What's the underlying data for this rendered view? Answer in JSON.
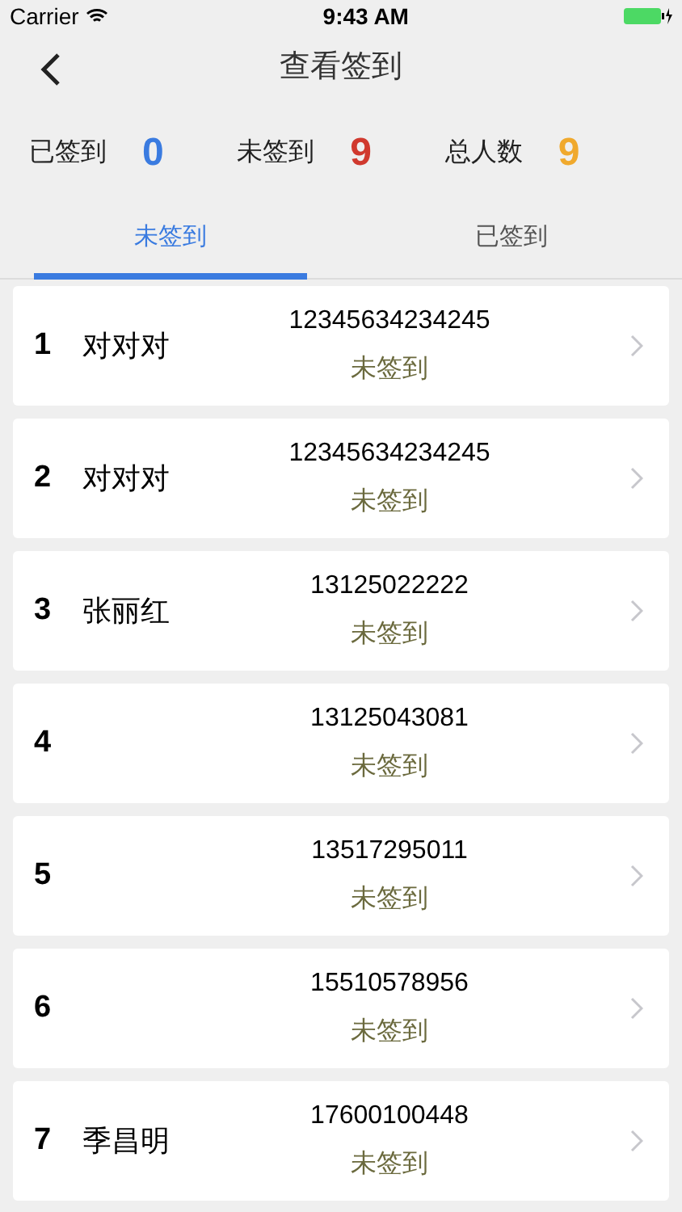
{
  "status_bar": {
    "carrier": "Carrier",
    "time": "9:43 AM"
  },
  "nav": {
    "title": "查看签到"
  },
  "stats": [
    {
      "label": "已签到",
      "value": "0",
      "color": "#3a7be0"
    },
    {
      "label": "未签到",
      "value": "9",
      "color": "#d0392e"
    },
    {
      "label": "总人数",
      "value": "9",
      "color": "#f0a92d"
    }
  ],
  "tabs": [
    {
      "label": "未签到",
      "selected": true
    },
    {
      "label": "已签到",
      "selected": false
    }
  ],
  "rows": [
    {
      "index": "1",
      "name": "对对对",
      "phone": "12345634234245",
      "status": "未签到"
    },
    {
      "index": "2",
      "name": "对对对",
      "phone": "12345634234245",
      "status": "未签到"
    },
    {
      "index": "3",
      "name": "张丽红",
      "phone": "13125022222",
      "status": "未签到"
    },
    {
      "index": "4",
      "phone": "13125043081",
      "status": "未签到"
    },
    {
      "index": "5",
      "phone": "13517295011",
      "status": "未签到"
    },
    {
      "index": "6",
      "phone": "15510578956",
      "status": "未签到"
    },
    {
      "index": "7",
      "name": "季昌明",
      "phone": "17600100448",
      "status": "未签到"
    }
  ]
}
